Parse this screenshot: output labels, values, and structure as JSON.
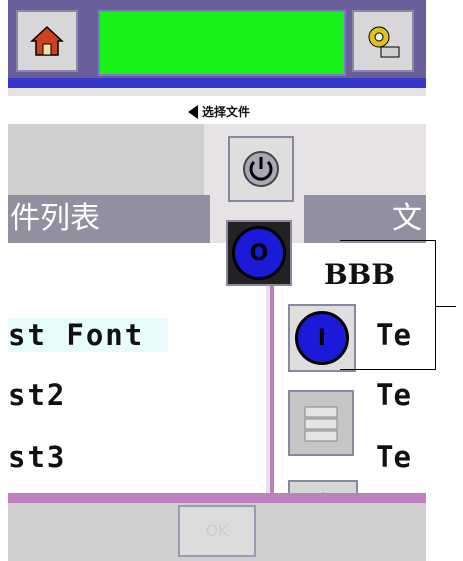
{
  "header": {
    "home_icon": "home-icon",
    "settings_icon": "gear-icon",
    "display_color": "#18f218",
    "subtitle": "选择文件"
  },
  "panel": {
    "title_left": "件列表",
    "title_right": "文",
    "items_left": [
      "st Font",
      "st2",
      "st3"
    ],
    "items_right": [
      "Te",
      "Te",
      "Te"
    ],
    "selected": "BBB"
  },
  "controls": {
    "power_icon": "power-icon",
    "stop_label": "O",
    "start_label": "I",
    "ok_label": "OK",
    "dpad_icon": "dpad-icon"
  },
  "colors": {
    "accent_blue": "#1a1ad8",
    "header_purple": "#6a5f9a",
    "list_divider": "#c080c0"
  }
}
